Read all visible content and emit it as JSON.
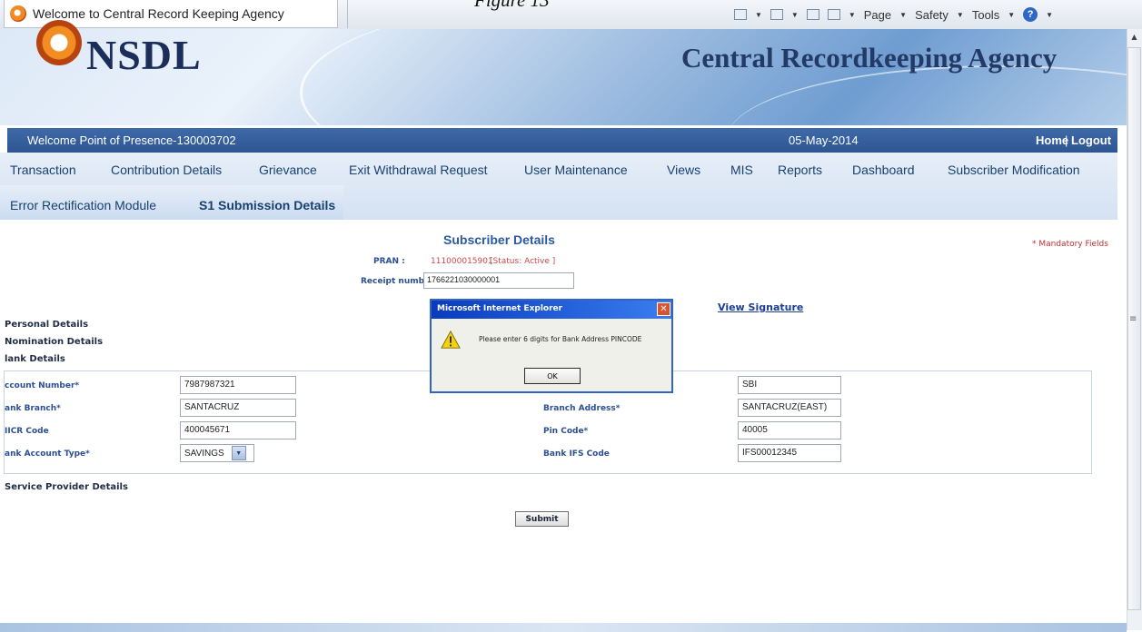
{
  "caption": "Figure 13",
  "browser": {
    "tab_title": "Welcome to Central Record Keeping Agency",
    "tools": [
      "Page",
      "Safety",
      "Tools"
    ]
  },
  "banner": {
    "logo": "NSDL",
    "agency": "Central Recordkeeping Agency"
  },
  "header": {
    "welcome": "Welcome Point of Presence-130003702",
    "date": "05-May-2014",
    "home": "Home",
    "separator": "|",
    "logout": "Logout"
  },
  "menu": {
    "items": [
      "Transaction",
      "Contribution Details",
      "Grievance",
      "Exit Withdrawal Request",
      "User Maintenance",
      "Views",
      "MIS",
      "Reports",
      "Dashboard",
      "Subscriber Modification",
      "Error Rectification Module",
      "S1 Submission Details"
    ]
  },
  "subscriber": {
    "title": "Subscriber Details",
    "mandatory_note": "* Mandatory Fields",
    "pran_label": "PRAN :",
    "pran_value": "111000015901",
    "status": "[Status: Active ]",
    "receipt_label": "Receipt number",
    "receipt_value": "1766221030000001",
    "view_signature": "View Signature"
  },
  "sections": {
    "personal": "Personal Details",
    "nomination": "Nomination Details",
    "bank": "lank Details",
    "service_provider": "Service Provider Details"
  },
  "bank_fields": {
    "account_number_label": "ccount Number*",
    "account_number": "7987987321",
    "bank_branch_label": "ank Branch*",
    "bank_branch": "SANTACRUZ",
    "micr_label": "IICR Code",
    "micr": "400045671",
    "account_type_label": "ank Account Type*",
    "account_type": "SAVINGS",
    "bank_name": "SBI",
    "branch_address_label": "Branch Address*",
    "branch_address": "SANTACRUZ(EAST)",
    "pin_label": "Pin Code*",
    "pin": "40005",
    "ifs_label": "Bank IFS Code",
    "ifs": "IFS00012345"
  },
  "submit_label": "Submit",
  "dialog": {
    "title": "Microsoft Internet Explorer",
    "message": "Please enter 6 digits for Bank Address PINCODE",
    "ok": "OK"
  }
}
